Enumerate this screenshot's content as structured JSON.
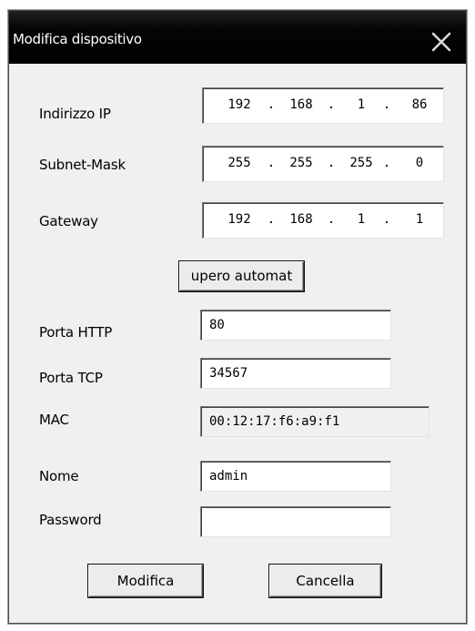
{
  "dialog": {
    "title": "Modifica dispositivo",
    "close_icon": "close-icon"
  },
  "fields": {
    "ip": {
      "label": "Indirizzo IP",
      "octets": [
        "192",
        "168",
        "1",
        "86"
      ]
    },
    "subnet": {
      "label": "Subnet-Mask",
      "octets": [
        "255",
        "255",
        "255",
        "0"
      ]
    },
    "gateway": {
      "label": "Gateway",
      "octets": [
        "192",
        "168",
        "1",
        "1"
      ]
    },
    "auto_button": "upero automat",
    "http_port": {
      "label": "Porta HTTP",
      "value": "80"
    },
    "tcp_port": {
      "label": "Porta TCP",
      "value": "34567"
    },
    "mac": {
      "label": "MAC",
      "value": "00:12:17:f6:a9:f1"
    },
    "name": {
      "label": "Nome",
      "value": "admin"
    },
    "password": {
      "label": "Password",
      "value": ""
    }
  },
  "buttons": {
    "modify": "Modifica",
    "cancel": "Cancella"
  }
}
